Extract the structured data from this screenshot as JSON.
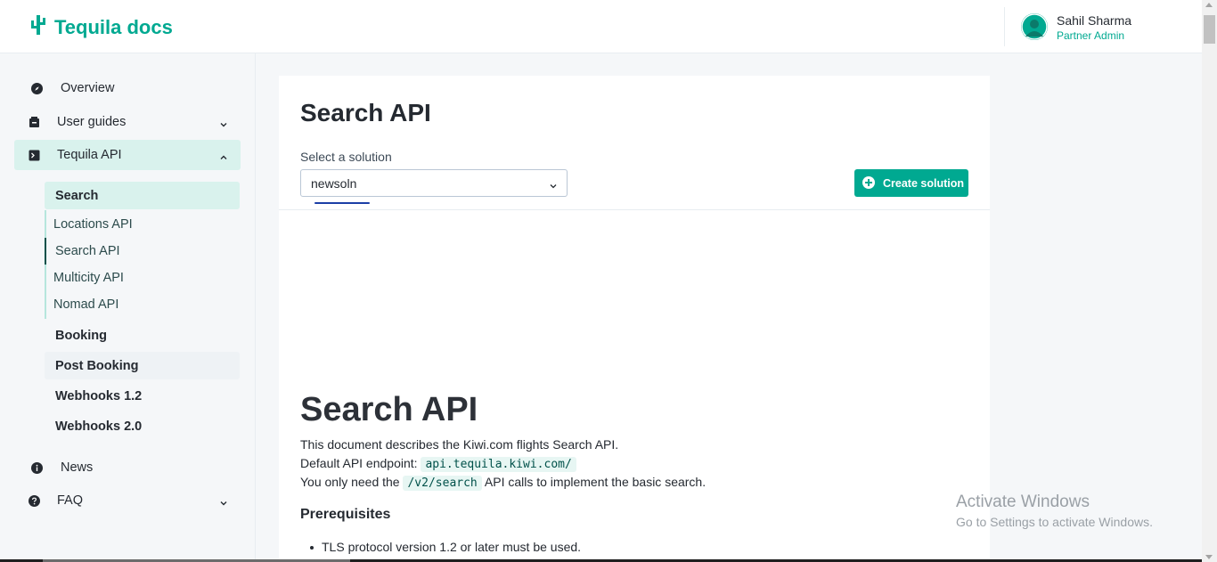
{
  "header": {
    "logo_text": "Tequila docs",
    "logo_icon": "cactus-icon",
    "user_name": "Sahil Sharma",
    "user_role": "Partner Admin"
  },
  "sidebar": {
    "items": [
      {
        "label": "Overview",
        "icon": "compass-icon"
      },
      {
        "label": "User guides",
        "icon": "book-icon"
      },
      {
        "label": "Tequila API",
        "icon": "terminal-icon"
      },
      {
        "label": "News",
        "icon": "info-icon"
      },
      {
        "label": "FAQ",
        "icon": "question-icon"
      }
    ],
    "api_sections": [
      "Search",
      "Booking",
      "Post Booking",
      "Webhooks 1.2",
      "Webhooks 2.0"
    ],
    "search_children": [
      "Locations API",
      "Search API",
      "Multicity API",
      "Nomad API"
    ]
  },
  "main": {
    "page_title": "Search API",
    "select_label": "Select a solution",
    "select_value": "newsoln",
    "create_button": "Create solution",
    "doc_title": "Search API",
    "line1": "This document describes the Kiwi.com flights Search API.",
    "line2_prefix": "Default API endpoint:",
    "line2_code": "api.tequila.kiwi.com/",
    "line3_prefix": "You only need the",
    "line3_code": "/v2/search",
    "line3_suffix": "API calls to implement the basic search.",
    "prereq_heading": "Prerequisites",
    "prereq_item1": "TLS protocol version 1.2 or later must be used."
  },
  "watermark": {
    "line1": "Activate Windows",
    "line2": "Go to Settings to activate Windows."
  },
  "colors": {
    "brand": "#00a991",
    "active_bg": "#d9f2ed"
  }
}
